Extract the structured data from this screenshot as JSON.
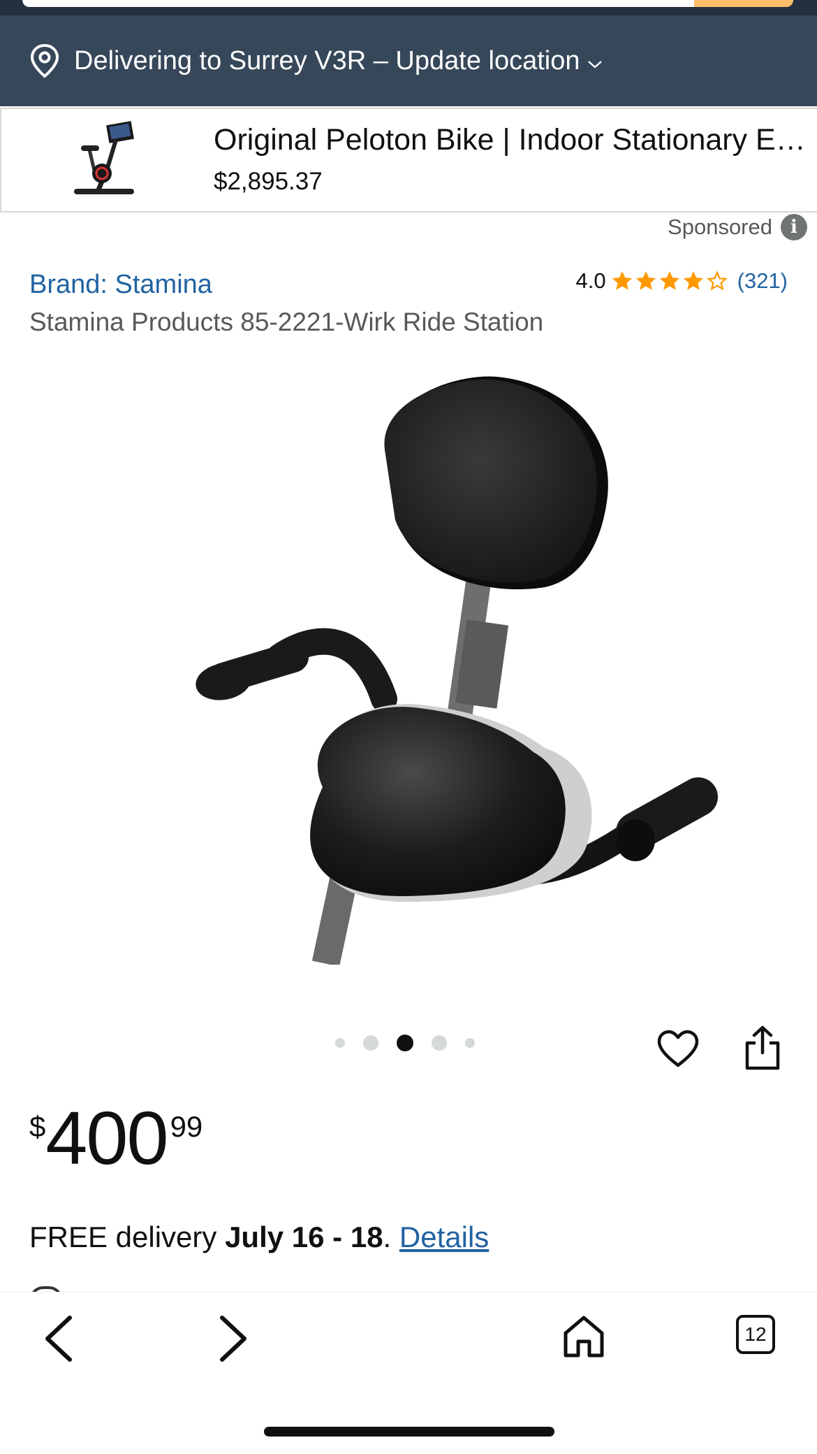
{
  "delivery_bar": {
    "text": "Delivering to Surrey V3R – Update location",
    "icon": "location-pin-icon"
  },
  "sponsored_product": {
    "title": "Original Peloton Bike | Indoor Stationary Exercise Bike",
    "price": "$2,895.37",
    "sponsored_label": "Sponsored",
    "info_glyph": "i"
  },
  "product": {
    "brand_link": "Brand: Stamina",
    "rating_value": "4.0",
    "rating_stars": 4,
    "rating_count": "(321)",
    "title": "Stamina Products 85-2221-Wirk Ride Station",
    "price": {
      "currency": "$",
      "whole": "400",
      "fraction": "99"
    },
    "delivery": {
      "prefix": "FREE delivery ",
      "dates": "July 16 - 18",
      "separator": ". ",
      "details_link": "Details"
    },
    "carousel": {
      "total": 5,
      "active_index": 2
    }
  },
  "toolbar": {
    "tab_count": "12"
  },
  "colors": {
    "header_bg": "#37475a",
    "link": "#2162a1",
    "star": "#ff9900",
    "search_button": "#febd69"
  }
}
